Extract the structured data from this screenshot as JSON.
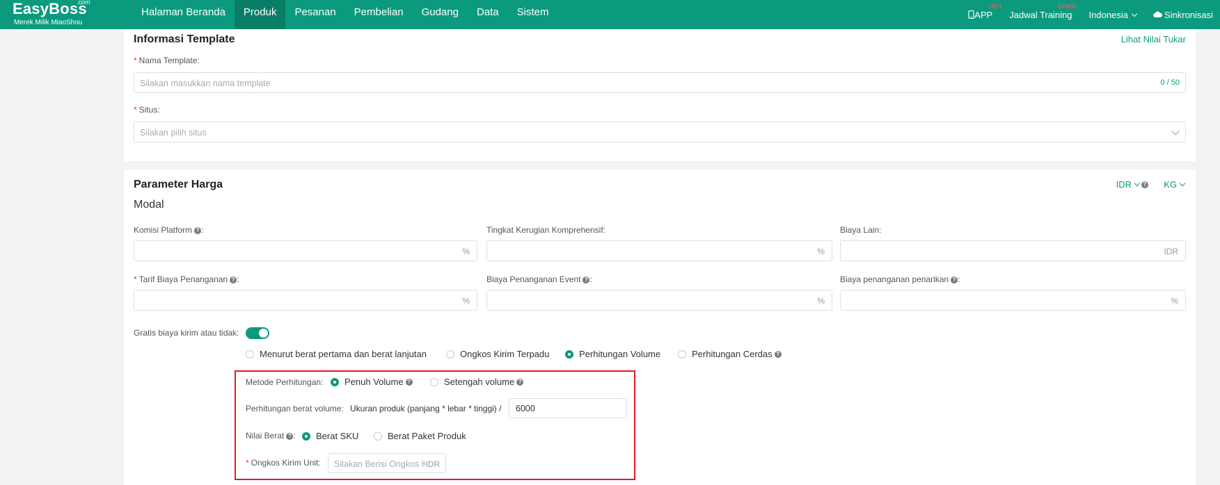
{
  "brand": {
    "name": "EasyBoss",
    "com": ".com",
    "subtitle": "Merek Milik MiaoShou"
  },
  "nav": {
    "items": [
      {
        "label": "Halaman Beranda"
      },
      {
        "label": "Produk"
      },
      {
        "label": "Pesanan"
      },
      {
        "label": "Pembelian"
      },
      {
        "label": "Gudang"
      },
      {
        "label": "Data"
      },
      {
        "label": "Sistem"
      }
    ],
    "active": "Produk",
    "right": {
      "app": "APP",
      "app_badge": "HOT",
      "training": "Jadwal Training",
      "training_badge": "Gratis",
      "language": "Indonesia",
      "sync": "Sinkronisasi"
    }
  },
  "template_info": {
    "title": "Informasi Template",
    "link": "Lihat Nilai Tukar",
    "name_label": "Nama Template:",
    "name_placeholder": "Silakan masukkan nama template",
    "name_counter": "0 / 50",
    "site_label": "Situs:",
    "site_placeholder": "Silakan pilih situs"
  },
  "price_params": {
    "title": "Parameter Harga",
    "currency": "IDR",
    "weight_unit": "KG",
    "modal_title": "Modal",
    "commission_label": "Komisi Platform",
    "commission_suffix": "%",
    "loss_label": "Tingkat Kerugian Komprehensif:",
    "loss_suffix": "%",
    "other_label": "Biaya Lain:",
    "other_suffix": "IDR",
    "handling_label": "Tarif Biaya Penanganan",
    "handling_suffix": "%",
    "event_label": "Biaya Penanganan Event",
    "event_suffix": "%",
    "withdraw_label": "Biaya penanganan penarikan",
    "withdraw_suffix": "%",
    "free_shipping_label": "Gratis biaya kirim atau tidak:",
    "free_shipping_on": true,
    "shipping_options": [
      "Menurut berat pertama dan berat lanjutan",
      "Ongkos Kirim Terpadu",
      "Perhitungan Volume",
      "Perhitungan Cerdas"
    ],
    "shipping_selected": "Perhitungan Volume",
    "method_label": "Metode Perhitungan:",
    "method_options": [
      "Penuh Volume",
      "Setengah volume"
    ],
    "method_selected": "Penuh Volume",
    "volume_label": "Perhitungan berat volume:",
    "volume_formula": "Ukuran produk (panjang * lebar * tinggi) /",
    "volume_divisor": "6000",
    "weight_value_label": "Nilai Berat",
    "weight_options": [
      "Berat SKU",
      "Berat Paket Produk"
    ],
    "weight_selected": "Berat SKU",
    "unit_shipping_label": "Ongkos Kirim Unit:",
    "unit_shipping_placeholder": "Silakan Berisi Ongkos Ki",
    "unit_shipping_suffix": "IDR"
  },
  "colors": {
    "primary": "#0b9a7d",
    "highlight": "#e3172b",
    "required": "#e63b3b"
  }
}
